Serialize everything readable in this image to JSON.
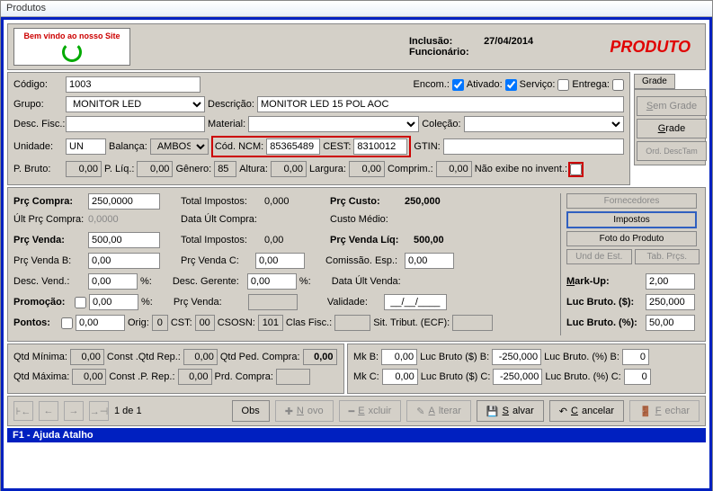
{
  "window": {
    "title": "Produtos"
  },
  "header": {
    "inclusao_lbl": "Inclusão:",
    "inclusao_val": "27/04/2014",
    "func_lbl": "Funcionário:",
    "produto": "PRODUTO",
    "logo_text": "Bem vindo ao nosso Site"
  },
  "top": {
    "codigo_lbl": "Código:",
    "codigo": "1003",
    "encom_lbl": "Encom.:",
    "ativado_lbl": "Ativado:",
    "servico_lbl": "Serviço:",
    "entrega_lbl": "Entrega:",
    "grupo_lbl": "Grupo:",
    "grupo": "MONITOR LED",
    "descricao_lbl": "Descrição:",
    "descricao": "MONITOR LED 15 POL AOC",
    "descfisc_lbl": "Desc. Fisc.:",
    "material_lbl": "Material:",
    "colecao_lbl": "Coleção:",
    "unidade_lbl": "Unidade:",
    "unidade": "UN",
    "balanca_lbl": "Balança:",
    "balanca": "AMBOS",
    "codncm_lbl": "Cód. NCM:",
    "codncm": "85365489",
    "cest_lbl": "CEST:",
    "cest": "8310012",
    "gtin_lbl": "GTIN:",
    "pbruto_lbl": "P. Bruto:",
    "pbruto": "0,00",
    "pliq_lbl": "P. Líq.:",
    "pliq": "0,00",
    "genero_lbl": "Gênero:",
    "genero": "85",
    "altura_lbl": "Altura:",
    "altura": "0,00",
    "largura_lbl": "Largura:",
    "largura": "0,00",
    "comprim_lbl": "Comprim.:",
    "comprim": "0,00",
    "naoexibe_lbl": "Não exibe no invent.:"
  },
  "side": {
    "grade": "Grade",
    "sem_grade": "Sem Grade",
    "grade_btn": "Grade",
    "ord": "Ord. DescTam"
  },
  "mid": {
    "prc_compra_lbl": "Prç Compra:",
    "prc_compra": "250,0000",
    "total_imp_lbl": "Total Impostos:",
    "total_imp": "0,000",
    "prc_custo_lbl": "Prç Custo:",
    "prc_custo": "250,000",
    "ult_prc_lbl": "Últ Prç Compra:",
    "ult_prc": "0,0000",
    "data_ult_lbl": "Data Últ Compra:",
    "custo_medio_lbl": "Custo Médio:",
    "prc_venda_lbl": "Prç Venda:",
    "prc_venda": "500,00",
    "total_imp2": "0,00",
    "prc_venda_liq_lbl": "Prç Venda Líq:",
    "prc_venda_liq": "500,00",
    "prc_vendab_lbl": "Prç Venda B:",
    "prc_vendab": "0,00",
    "prc_vendac_lbl": "Prç Venda C:",
    "prc_vendac": "0,00",
    "comissao_lbl": "Comissão. Esp.:",
    "comissao": "0,00",
    "desc_vend_lbl": "Desc. Vend.:",
    "desc_vend": "0,00",
    "desc_ger_lbl": "Desc. Gerente:",
    "desc_ger": "0,00",
    "data_ult_v_lbl": "Data Últ Venda:",
    "promocao_lbl": "Promoção:",
    "promocao": "0,00",
    "prc_venda2_lbl": "Prç Venda:",
    "validade_lbl": "Validade:",
    "validade": "__/__/____",
    "pontos_lbl": "Pontos:",
    "pontos": "0,00",
    "orig_lbl": "Orig:",
    "orig": "0",
    "cst_lbl": "CST:",
    "cst": "00",
    "csosn_lbl": "CSOSN:",
    "csosn": "101",
    "clasfisc_lbl": "Clas Fisc.:",
    "sit_lbl": "Sit. Tribut. (ECF):",
    "pct": "%:",
    "fornecedores": "Fornecedores",
    "impostos": "Impostos",
    "foto": "Foto do Produto",
    "und_est": "Und de Est.",
    "tab_prcs": "Tab. Prçs.",
    "markup_lbl": "Mark-Up:",
    "markup": "2,00",
    "luc_bruto_s_lbl": "Luc Bruto. ($):",
    "luc_bruto_s": "250,000",
    "luc_bruto_p_lbl": "Luc Bruto. (%):",
    "luc_bruto_p": "50,00"
  },
  "bot": {
    "qtd_min_lbl": "Qtd Mínima:",
    "qtd_min": "0,00",
    "const_qtd_lbl": "Const .Qtd Rep.:",
    "const_qtd": "0,00",
    "qtd_ped_lbl": "Qtd Ped. Compra:",
    "qtd_ped": "0,00",
    "qtd_max_lbl": "Qtd Máxima:",
    "qtd_max": "0,00",
    "const_p_lbl": "Const .P. Rep.:",
    "const_p": "0,00",
    "prd_compra_lbl": "Prd. Compra:",
    "mkb_lbl": "Mk B:",
    "mkb": "0,00",
    "luc_b_s_lbl": "Luc Bruto ($) B:",
    "luc_b_s": "-250,000",
    "luc_b_p_lbl": "Luc Bruto. (%) B:",
    "luc_b_p": "0",
    "mkc_lbl": "Mk C:",
    "mkc": "0,00",
    "luc_c_s_lbl": "Luc Bruto ($) C:",
    "luc_c_s": "-250,000",
    "luc_c_p_lbl": "Luc Bruto. (%) C:",
    "luc_c_p": "0"
  },
  "toolbar": {
    "page": "1 de 1",
    "obs": "Obs",
    "novo": "Novo",
    "excluir": "Excluir",
    "alterar": "Alterar",
    "salvar": "Salvar",
    "cancelar": "Cancelar",
    "fechar": "Fechar"
  },
  "status": "F1 - Ajuda Atalho"
}
